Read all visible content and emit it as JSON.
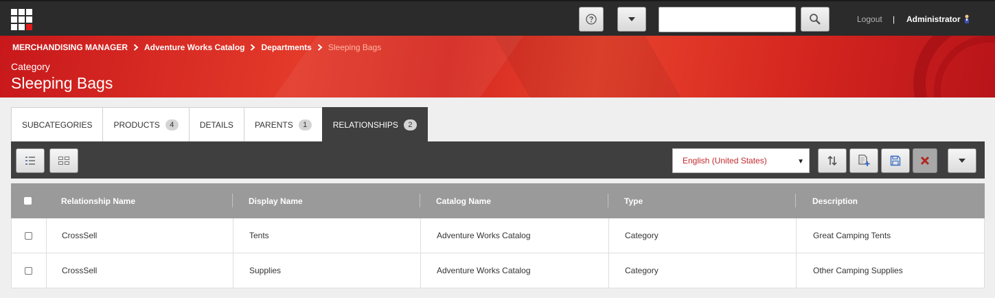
{
  "topbar": {
    "search_placeholder": "",
    "logout_label": "Logout",
    "separator": "|",
    "user_name": "Administrator"
  },
  "breadcrumb": [
    "MERCHANDISING MANAGER",
    "Adventure Works Catalog",
    "Departments",
    "Sleeping Bags"
  ],
  "header": {
    "category_label": "Category",
    "title": "Sleeping Bags"
  },
  "tabs": [
    {
      "label": "SUBCATEGORIES",
      "count": null,
      "active": false
    },
    {
      "label": "PRODUCTS",
      "count": "4",
      "active": false
    },
    {
      "label": "DETAILS",
      "count": null,
      "active": false
    },
    {
      "label": "PARENTS",
      "count": "1",
      "active": false
    },
    {
      "label": "RELATIONSHIPS",
      "count": "2",
      "active": true
    }
  ],
  "toolbar": {
    "language": "English (United States)"
  },
  "grid": {
    "columns": [
      "Relationship Name",
      "Display Name",
      "Catalog Name",
      "Type",
      "Description"
    ],
    "rows": [
      [
        "CrossSell",
        "Tents",
        "Adventure Works Catalog",
        "Category",
        "Great Camping Tents"
      ],
      [
        "CrossSell",
        "Supplies",
        "Adventure Works Catalog",
        "Category",
        "Other Camping Supplies"
      ]
    ]
  },
  "colors": {
    "accent_red": "#d42820",
    "topbar_bg": "#2b2b2b",
    "toolbar_bg": "#3f3f3f",
    "grid_header_bg": "#9a9a9a",
    "language_text": "#c0282d"
  }
}
